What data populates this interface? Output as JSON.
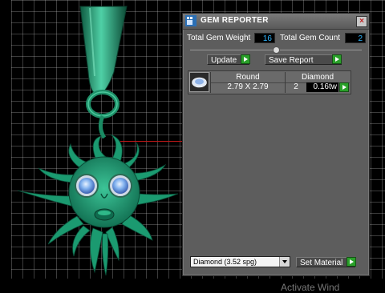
{
  "panel": {
    "title": "GEM REPORTER",
    "close_label": "×",
    "total_gem_weight_label": "Total Gem Weight",
    "total_gem_weight_value": "16",
    "total_gem_count_label": "Total Gem Count",
    "total_gem_count_value": "2",
    "update_label": "Update",
    "save_report_label": "Save Report",
    "slider_level": 0.5
  },
  "gem_table": {
    "columns": [
      "Round",
      "Diamond"
    ],
    "rows": [
      {
        "shape_size": "2.79 X 2.79",
        "count": "2",
        "weight": "0.16tw"
      }
    ]
  },
  "footer": {
    "material_value": "Diamond   (3.52 spg)",
    "set_material_label": "Set Material"
  },
  "watermark": "Activate Wind",
  "colors": {
    "panel_bg": "#5d5d5d",
    "value_text": "#2fb6ff",
    "play_button": "#2aa02a",
    "pendant_green": "#1fa27a",
    "gem_blue": "#6fa6e8"
  },
  "icons": [
    "gem-reporter-app-icon",
    "close-icon",
    "play-icon",
    "gem-thumbnail-icon",
    "dropdown-arrow-icon"
  ]
}
